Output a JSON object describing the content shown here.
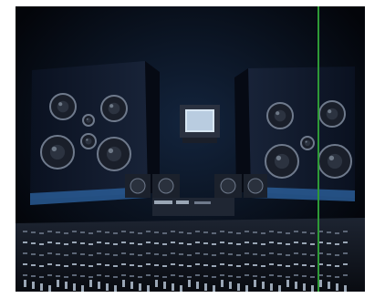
{
  "image": {
    "subject": "recording-studio-control-room",
    "colors": {
      "background": "#ffffff",
      "room": "#05070c",
      "speaker_cabinet": "#0d1524",
      "speaker_cone": "#1a1f2a",
      "speaker_rim": "#6f7a8c",
      "accent_blue": "#4d8fd6",
      "monitor_screen": "#d8e6f2",
      "console": "#151922",
      "console_highlight": "#9aa6b5",
      "green_line": "#2e9a37"
    },
    "icons": [
      "speaker-icon",
      "monitor-icon",
      "mixing-console-icon"
    ]
  }
}
